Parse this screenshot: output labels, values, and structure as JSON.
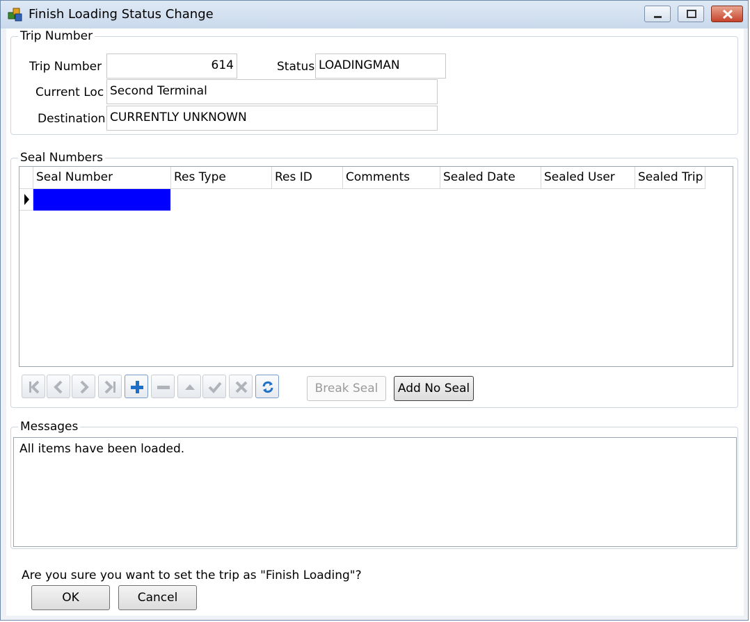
{
  "window": {
    "title": "Finish Loading Status Change"
  },
  "trip_group": {
    "legend": "Trip Number",
    "trip_number_label": "Trip Number",
    "trip_number_value": "614",
    "status_label": "Status",
    "status_value": "LOADINGMAN",
    "current_loc_label": "Current Loc",
    "current_loc_value": "Second Terminal",
    "destination_label": "Destination",
    "destination_value": "CURRENTLY UNKNOWN"
  },
  "seal_group": {
    "legend": "Seal Numbers",
    "columns": [
      "Seal Number",
      "Res Type",
      "Res ID",
      "Comments",
      "Sealed Date",
      "Sealed User",
      "Sealed Trip"
    ],
    "navigator_icons": [
      "first-icon",
      "prior-icon",
      "next-icon",
      "last-icon",
      "insert-icon",
      "delete-icon",
      "edit-icon",
      "post-icon",
      "cancel-icon",
      "refresh-icon"
    ],
    "break_seal_label": "Break Seal",
    "add_no_seal_label": "Add No Seal"
  },
  "messages": {
    "legend": "Messages",
    "text": "All items have been loaded."
  },
  "footer": {
    "question": "Are you sure you want to set the trip as \"Finish Loading\"?",
    "ok_label": "OK",
    "cancel_label": "Cancel"
  },
  "colors": {
    "selection": "#0000ff",
    "accent": "#1e6fc8"
  }
}
